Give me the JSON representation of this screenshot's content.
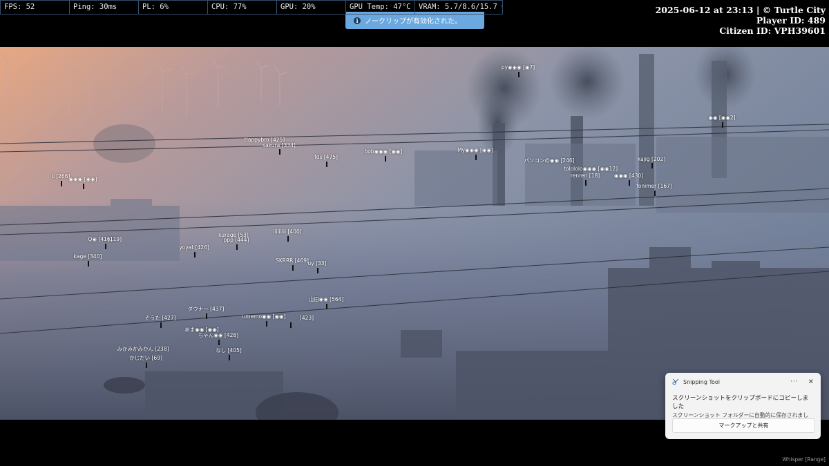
{
  "hud": {
    "fps": "FPS: 52",
    "ping": "Ping: 30ms",
    "pl": "PL: 6%",
    "cpu": "CPU: 77%",
    "gpu": "GPU: 20%",
    "gpu_temp": "GPU Temp: 47°C",
    "vram": "VRAM: 5.7/8.6/15.7 GB"
  },
  "notice": {
    "icon": "info-icon",
    "text": "ノークリップが有効化された。"
  },
  "server": {
    "datetime": "2025-06-12 at 23:13 | © Turtle City",
    "player_id": "Player ID: 489",
    "citizen_id": "Citizen ID: VPH39601"
  },
  "player_tags": [
    "py◉◉◉ [◉7]",
    "◉◉ [◉◉2]",
    "tlappybro [425]",
    "sakura [334]",
    "fds [475]",
    "bob◉◉◉ [◉◉]",
    "My◉◉◉ [◉◉]",
    "パソコンの◉◉ [246]",
    "kajig [202]",
    "tolololo◉◉◉ [◉◉12]",
    "renren [18]",
    "◉◉◉ [430]",
    "fonimer [167]",
    "L [266]",
    "◉◉◉ [◉◉]",
    "kurage [53]",
    "ppp [444]",
    "iiiiiiiii [400]",
    "Q◉ [416]",
    "[119]",
    "yoyat [426]",
    "kage [340]",
    "SKRRR [469]",
    "uy [33]",
    "山田◉◉ [564]",
    "ダウナー [437]",
    "そうた [427]",
    "umemo◉◉ [◉◉]",
    "[423]",
    "あま◉◉ [◉◉]",
    "ちゃん◉◉ [428]",
    "みかみかみかん [238]",
    "なし [405]",
    "かじだい [69]"
  ],
  "snipping_toast": {
    "app_icon": "snipping-tool-icon",
    "app_name": "Snipping Tool",
    "more_icon": "more-icon",
    "close_icon": "close-icon",
    "title": "スクリーンショットをクリップボードにコピーしました",
    "body": "スクリーンショット フォルダーに自動的に保存されました。",
    "button": "マークアップと共有"
  },
  "voice_mode": "Whisper [Range]",
  "colors": {
    "hud_border": "#35506e",
    "notice_bg": "#6aa8df",
    "toast_bg": "#f3f3f3"
  }
}
